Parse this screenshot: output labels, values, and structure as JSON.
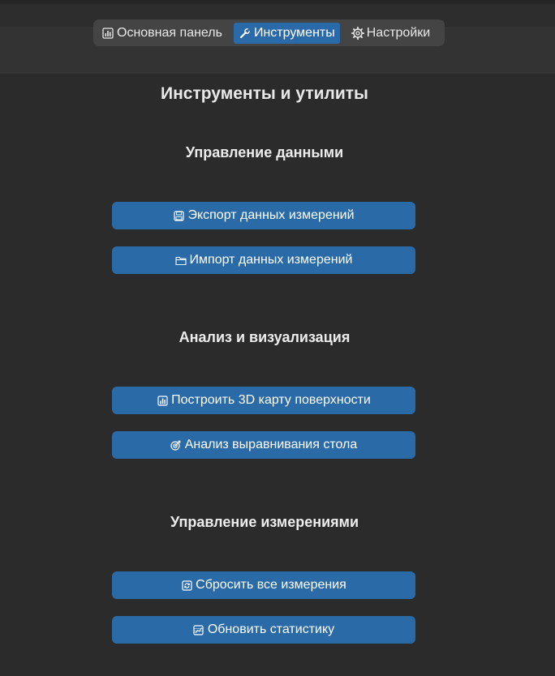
{
  "tabs": [
    {
      "label": "Основная панель",
      "icon": "bar-chart-icon",
      "active": false
    },
    {
      "label": "Инструменты",
      "icon": "wrench-icon",
      "active": true
    },
    {
      "label": "Настройки",
      "icon": "gear-icon",
      "active": false
    }
  ],
  "page": {
    "title": "Инструменты и утилиты"
  },
  "sections": [
    {
      "title": "Управление данными",
      "buttons": [
        {
          "label": "Экспорт данных измерений",
          "icon": "floppy-disk-icon"
        },
        {
          "label": "Импорт данных измерений",
          "icon": "folder-icon"
        }
      ]
    },
    {
      "title": "Анализ и визуализация",
      "buttons": [
        {
          "label": "Построить 3D карту поверхности",
          "icon": "bar-chart-icon"
        },
        {
          "label": "Анализ выравнивания стола",
          "icon": "target-icon"
        }
      ]
    },
    {
      "title": "Управление измерениями",
      "buttons": [
        {
          "label": "Сбросить все измерения",
          "icon": "refresh-icon"
        },
        {
          "label": "Обновить статистику",
          "icon": "line-chart-icon"
        }
      ]
    }
  ],
  "colors": {
    "background": "#2b2b2b",
    "accent": "#2a6aa7",
    "tabbar": "#444444"
  }
}
